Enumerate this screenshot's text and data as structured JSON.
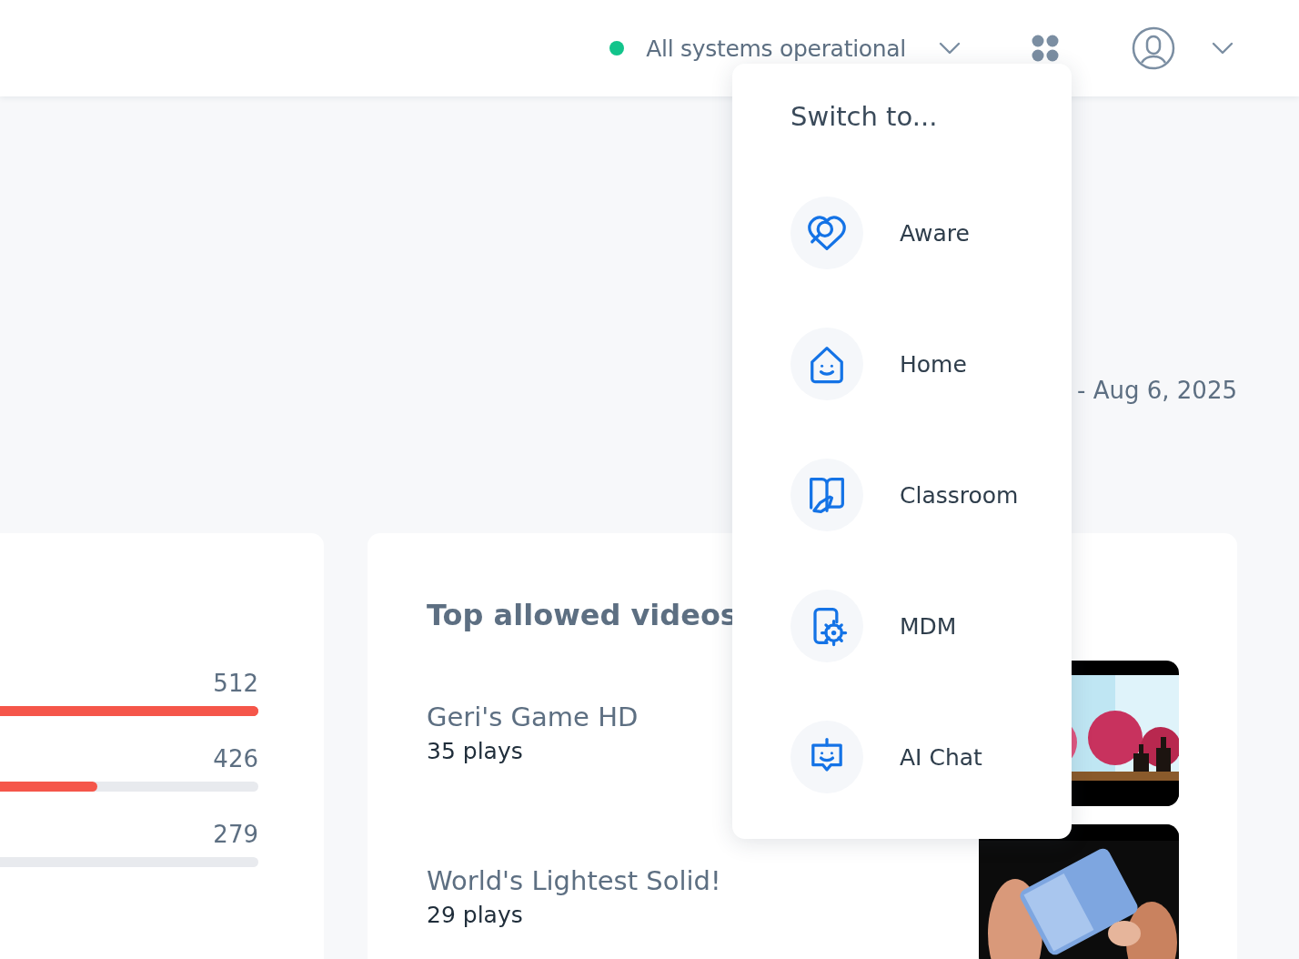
{
  "header": {
    "status": "All systems operational"
  },
  "date_range": "- Aug 6, 2025",
  "bar_list": [
    {
      "value": "512",
      "level": 1
    },
    {
      "value": "426",
      "level": 0.54
    },
    {
      "value": "279",
      "level": 0
    }
  ],
  "videos_card": {
    "title": "Top allowed videos",
    "videos": [
      {
        "title": "Geri's Game HD",
        "plays": "35 plays"
      },
      {
        "title": "World's Lightest Solid!",
        "plays": "29 plays"
      }
    ]
  },
  "switcher": {
    "title": "Switch to...",
    "items": [
      {
        "label": "Aware"
      },
      {
        "label": "Home"
      },
      {
        "label": "Classroom"
      },
      {
        "label": "MDM"
      },
      {
        "label": "AI Chat"
      }
    ]
  }
}
